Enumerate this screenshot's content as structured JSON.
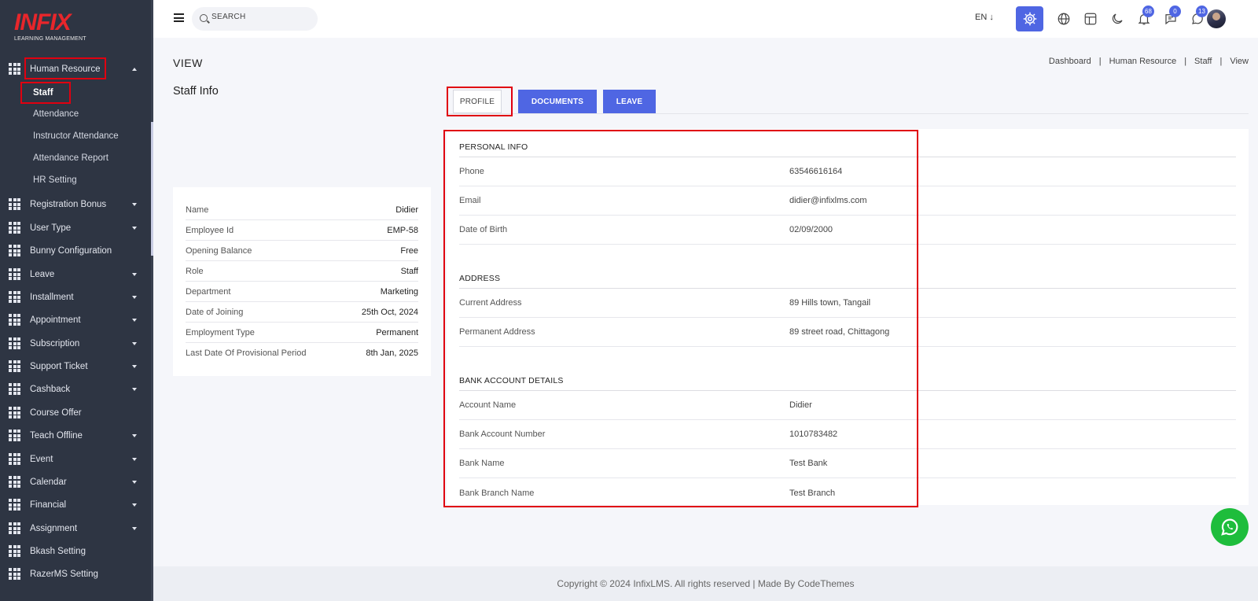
{
  "brand": {
    "logo_text": "INFIX",
    "tagline": "LEARNING MANAGEMENT",
    "accent": "#4f66e3",
    "highlight": "#e00010"
  },
  "sidebar": {
    "active_group": {
      "label": "Human Resource",
      "icon": "grid-icon"
    },
    "sub_items": [
      "Staff",
      "Attendance",
      "Instructor Attendance",
      "Attendance Report",
      "HR Setting"
    ],
    "items": [
      {
        "label": "Registration Bonus",
        "caret": true
      },
      {
        "label": "User Type",
        "caret": true
      },
      {
        "label": "Bunny Configuration",
        "caret": false
      },
      {
        "label": "Leave",
        "caret": true
      },
      {
        "label": "Installment",
        "caret": true
      },
      {
        "label": "Appointment",
        "caret": true
      },
      {
        "label": "Subscription",
        "caret": true
      },
      {
        "label": "Support Ticket",
        "caret": true
      },
      {
        "label": "Cashback",
        "caret": true
      },
      {
        "label": "Course Offer",
        "caret": false
      },
      {
        "label": "Teach Offline",
        "caret": true
      },
      {
        "label": "Event",
        "caret": true
      },
      {
        "label": "Calendar",
        "caret": true
      },
      {
        "label": "Financial",
        "caret": true
      },
      {
        "label": "Assignment",
        "caret": true
      },
      {
        "label": "Bkash Setting",
        "caret": false
      },
      {
        "label": "RazerMS Setting",
        "caret": false
      }
    ]
  },
  "topbar": {
    "search_placeholder": "SEARCH",
    "language": "EN",
    "notifications": "68",
    "messages": "0",
    "chats": "13"
  },
  "page": {
    "title": "VIEW",
    "breadcrumb": [
      "Dashboard",
      "Human Resource",
      "Staff",
      "View"
    ],
    "section_title": "Staff Info"
  },
  "staff_info": [
    {
      "k": "Name",
      "v": "Didier"
    },
    {
      "k": "Employee Id",
      "v": "EMP-58"
    },
    {
      "k": "Opening Balance",
      "v": "Free"
    },
    {
      "k": "Role",
      "v": "Staff"
    },
    {
      "k": "Department",
      "v": "Marketing"
    },
    {
      "k": "Date of Joining",
      "v": "25th Oct, 2024"
    },
    {
      "k": "Employment Type",
      "v": "Permanent"
    },
    {
      "k": "Last Date Of Provisional Period",
      "v": "8th Jan, 2025"
    }
  ],
  "tabs": [
    "PROFILE",
    "DOCUMENTS",
    "LEAVE"
  ],
  "profile": {
    "personal_heading": "PERSONAL INFO",
    "personal": [
      {
        "k": "Phone",
        "v": "63546616164"
      },
      {
        "k": "Email",
        "v": "didier@infixlms.com"
      },
      {
        "k": "Date of Birth",
        "v": "02/09/2000"
      }
    ],
    "address_heading": "ADDRESS",
    "address": [
      {
        "k": "Current Address",
        "v": "89 Hills town, Tangail"
      },
      {
        "k": "Permanent Address",
        "v": "89 street road, Chittagong"
      }
    ],
    "bank_heading": "BANK ACCOUNT DETAILS",
    "bank": [
      {
        "k": "Account Name",
        "v": "Didier"
      },
      {
        "k": "Bank Account Number",
        "v": "1010783482"
      },
      {
        "k": "Bank Name",
        "v": "Test Bank"
      },
      {
        "k": "Bank Branch Name",
        "v": "Test Branch"
      }
    ]
  },
  "footer": {
    "text": "Copyright © 2024 InfixLMS. All rights reserved | Made By CodeThemes"
  }
}
